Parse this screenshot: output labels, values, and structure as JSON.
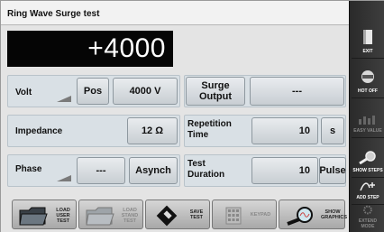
{
  "title": "Ring Wave Surge test",
  "display_value": "+4000",
  "volt": {
    "label": "Volt",
    "polarity": "Pos",
    "value": "4000 V"
  },
  "surge_output": {
    "label": "Surge Output",
    "value": "---"
  },
  "impedance": {
    "label": "Impedance",
    "value": "12 Ω"
  },
  "repetition_time": {
    "label": "Repetition Time",
    "value": "10",
    "unit": "s"
  },
  "phase": {
    "label": "Phase",
    "value": "---",
    "mode": "Asynch"
  },
  "test_duration": {
    "label": "Test Duration",
    "value": "10",
    "unit": "Pulse"
  },
  "bottom_toolbar": {
    "load_user_test": "LOAD USER TEST",
    "load_stand_test": "LOAD STAND TEST",
    "save_test": "SAVE TEST",
    "keypad": "KEYPAD",
    "show_graphics": "SHOW GRAPHICS"
  },
  "side_toolbar": {
    "exit": "EXIT",
    "hot_off": "HOT OFF",
    "easy_value": "EASY VALUE",
    "show_steps": "SHOW STEPS",
    "add_step": "ADD STEP",
    "extend_mode": "EXTEND MODE"
  },
  "colors": {
    "display_bg": "#050505",
    "panel_bg": "#d9e0e5",
    "sidebar_bg": "#333333"
  }
}
